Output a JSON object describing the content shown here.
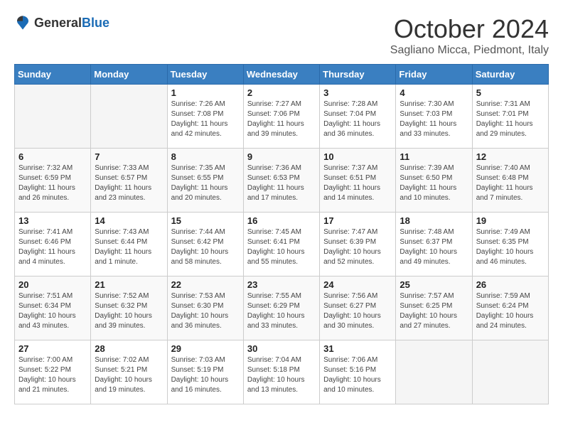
{
  "header": {
    "logo_general": "General",
    "logo_blue": "Blue",
    "month_title": "October 2024",
    "location": "Sagliano Micca, Piedmont, Italy"
  },
  "weekdays": [
    "Sunday",
    "Monday",
    "Tuesday",
    "Wednesday",
    "Thursday",
    "Friday",
    "Saturday"
  ],
  "weeks": [
    [
      {
        "day": "",
        "info": ""
      },
      {
        "day": "",
        "info": ""
      },
      {
        "day": "1",
        "info": "Sunrise: 7:26 AM\nSunset: 7:08 PM\nDaylight: 11 hours\nand 42 minutes."
      },
      {
        "day": "2",
        "info": "Sunrise: 7:27 AM\nSunset: 7:06 PM\nDaylight: 11 hours\nand 39 minutes."
      },
      {
        "day": "3",
        "info": "Sunrise: 7:28 AM\nSunset: 7:04 PM\nDaylight: 11 hours\nand 36 minutes."
      },
      {
        "day": "4",
        "info": "Sunrise: 7:30 AM\nSunset: 7:03 PM\nDaylight: 11 hours\nand 33 minutes."
      },
      {
        "day": "5",
        "info": "Sunrise: 7:31 AM\nSunset: 7:01 PM\nDaylight: 11 hours\nand 29 minutes."
      }
    ],
    [
      {
        "day": "6",
        "info": "Sunrise: 7:32 AM\nSunset: 6:59 PM\nDaylight: 11 hours\nand 26 minutes."
      },
      {
        "day": "7",
        "info": "Sunrise: 7:33 AM\nSunset: 6:57 PM\nDaylight: 11 hours\nand 23 minutes."
      },
      {
        "day": "8",
        "info": "Sunrise: 7:35 AM\nSunset: 6:55 PM\nDaylight: 11 hours\nand 20 minutes."
      },
      {
        "day": "9",
        "info": "Sunrise: 7:36 AM\nSunset: 6:53 PM\nDaylight: 11 hours\nand 17 minutes."
      },
      {
        "day": "10",
        "info": "Sunrise: 7:37 AM\nSunset: 6:51 PM\nDaylight: 11 hours\nand 14 minutes."
      },
      {
        "day": "11",
        "info": "Sunrise: 7:39 AM\nSunset: 6:50 PM\nDaylight: 11 hours\nand 10 minutes."
      },
      {
        "day": "12",
        "info": "Sunrise: 7:40 AM\nSunset: 6:48 PM\nDaylight: 11 hours\nand 7 minutes."
      }
    ],
    [
      {
        "day": "13",
        "info": "Sunrise: 7:41 AM\nSunset: 6:46 PM\nDaylight: 11 hours\nand 4 minutes."
      },
      {
        "day": "14",
        "info": "Sunrise: 7:43 AM\nSunset: 6:44 PM\nDaylight: 11 hours\nand 1 minute."
      },
      {
        "day": "15",
        "info": "Sunrise: 7:44 AM\nSunset: 6:42 PM\nDaylight: 10 hours\nand 58 minutes."
      },
      {
        "day": "16",
        "info": "Sunrise: 7:45 AM\nSunset: 6:41 PM\nDaylight: 10 hours\nand 55 minutes."
      },
      {
        "day": "17",
        "info": "Sunrise: 7:47 AM\nSunset: 6:39 PM\nDaylight: 10 hours\nand 52 minutes."
      },
      {
        "day": "18",
        "info": "Sunrise: 7:48 AM\nSunset: 6:37 PM\nDaylight: 10 hours\nand 49 minutes."
      },
      {
        "day": "19",
        "info": "Sunrise: 7:49 AM\nSunset: 6:35 PM\nDaylight: 10 hours\nand 46 minutes."
      }
    ],
    [
      {
        "day": "20",
        "info": "Sunrise: 7:51 AM\nSunset: 6:34 PM\nDaylight: 10 hours\nand 43 minutes."
      },
      {
        "day": "21",
        "info": "Sunrise: 7:52 AM\nSunset: 6:32 PM\nDaylight: 10 hours\nand 39 minutes."
      },
      {
        "day": "22",
        "info": "Sunrise: 7:53 AM\nSunset: 6:30 PM\nDaylight: 10 hours\nand 36 minutes."
      },
      {
        "day": "23",
        "info": "Sunrise: 7:55 AM\nSunset: 6:29 PM\nDaylight: 10 hours\nand 33 minutes."
      },
      {
        "day": "24",
        "info": "Sunrise: 7:56 AM\nSunset: 6:27 PM\nDaylight: 10 hours\nand 30 minutes."
      },
      {
        "day": "25",
        "info": "Sunrise: 7:57 AM\nSunset: 6:25 PM\nDaylight: 10 hours\nand 27 minutes."
      },
      {
        "day": "26",
        "info": "Sunrise: 7:59 AM\nSunset: 6:24 PM\nDaylight: 10 hours\nand 24 minutes."
      }
    ],
    [
      {
        "day": "27",
        "info": "Sunrise: 7:00 AM\nSunset: 5:22 PM\nDaylight: 10 hours\nand 21 minutes."
      },
      {
        "day": "28",
        "info": "Sunrise: 7:02 AM\nSunset: 5:21 PM\nDaylight: 10 hours\nand 19 minutes."
      },
      {
        "day": "29",
        "info": "Sunrise: 7:03 AM\nSunset: 5:19 PM\nDaylight: 10 hours\nand 16 minutes."
      },
      {
        "day": "30",
        "info": "Sunrise: 7:04 AM\nSunset: 5:18 PM\nDaylight: 10 hours\nand 13 minutes."
      },
      {
        "day": "31",
        "info": "Sunrise: 7:06 AM\nSunset: 5:16 PM\nDaylight: 10 hours\nand 10 minutes."
      },
      {
        "day": "",
        "info": ""
      },
      {
        "day": "",
        "info": ""
      }
    ]
  ]
}
